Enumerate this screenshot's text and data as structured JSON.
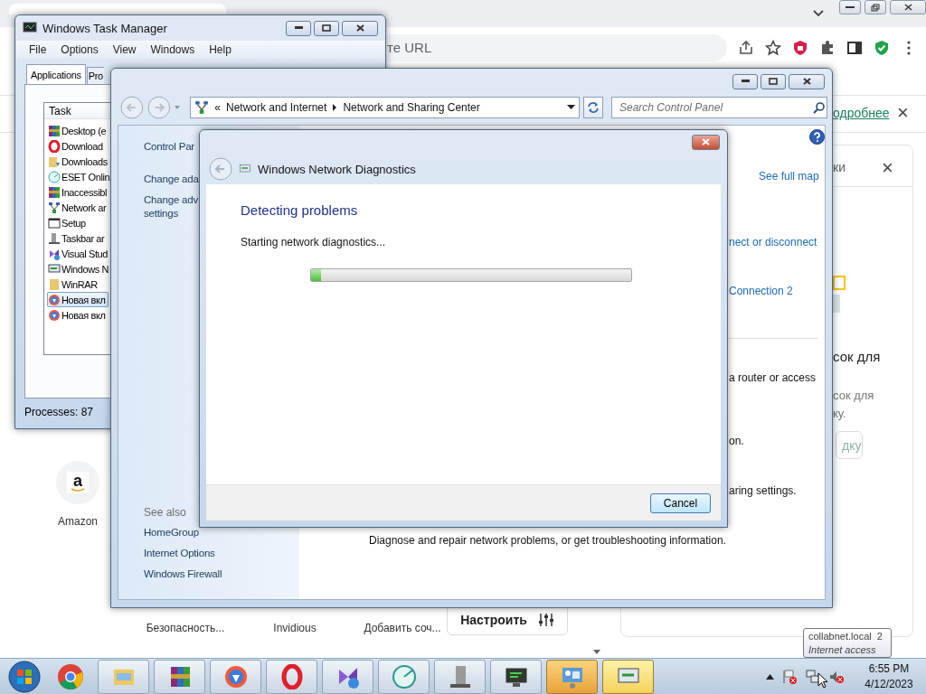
{
  "browser": {
    "url_fragment": "те URL",
    "infobar": {
      "link": "одробнее",
      "close": "×"
    },
    "side_panel": {
      "title": "ки",
      "close": "×",
      "heading": "сок для",
      "text_lines": [
        "сок для",
        "ку."
      ],
      "button": "дку"
    },
    "shortcuts": [
      {
        "label": "Amazon",
        "logo": "a"
      },
      {
        "label": "Безопасность..."
      },
      {
        "label": "Invidious"
      },
      {
        "label": "Добавить соч..."
      }
    ],
    "customize_button": "Настроить"
  },
  "task_manager": {
    "title": "Windows Task Manager",
    "menu": [
      "File",
      "Options",
      "View",
      "Windows",
      "Help"
    ],
    "tabs": [
      {
        "label": "Applications",
        "selected": true
      },
      {
        "label": "Pro",
        "selected": false
      }
    ],
    "column": "Task",
    "tasks": [
      {
        "name": "Desktop (e",
        "selected": false
      },
      {
        "name": "Download",
        "selected": false
      },
      {
        "name": "Downloads",
        "selected": false
      },
      {
        "name": "ESET Onlin",
        "selected": false
      },
      {
        "name": "Inaccessibl",
        "selected": false
      },
      {
        "name": "Network ar",
        "selected": false
      },
      {
        "name": "Setup",
        "selected": false
      },
      {
        "name": "Taskbar ar",
        "selected": false
      },
      {
        "name": "Visual Stud",
        "selected": false
      },
      {
        "name": "Windows N",
        "selected": false
      },
      {
        "name": "WinRAR",
        "selected": false
      },
      {
        "name": "Новая вкл",
        "selected": true
      },
      {
        "name": "Новая вкл",
        "selected": false
      }
    ],
    "status": "Processes: 87"
  },
  "control_panel": {
    "breadcrumb_prefix": "«",
    "breadcrumb": [
      "Network and Internet",
      "Network and Sharing Center"
    ],
    "search": {
      "placeholder": "Search Control Panel"
    },
    "left_links": [
      "Control Par",
      "Change ada",
      "Change adv\nsettings"
    ],
    "see_also_title": "See also",
    "see_also": [
      "HomeGroup",
      "Internet Options",
      "Windows Firewall"
    ],
    "right_pane": [
      {
        "kind": "link",
        "text": "See full map"
      },
      {
        "kind": "link",
        "text": "nect or disconnect"
      },
      {
        "kind": "link",
        "text": "Connection 2"
      },
      {
        "kind": "text",
        "text": "a router or access"
      },
      {
        "kind": "text",
        "text": "on."
      },
      {
        "kind": "text",
        "text": "aring settings."
      },
      {
        "kind": "text",
        "text": "Diagnose and repair network problems, or get troubleshooting information."
      }
    ]
  },
  "diagnostics_dialog": {
    "title": "Windows Network Diagnostics",
    "heading": "Detecting problems",
    "status": "Starting network diagnostics...",
    "progress": {
      "level": 0.03
    },
    "button": "Cancel"
  },
  "taskbar": {
    "apps": [
      {
        "active": false,
        "flashing": false
      },
      {
        "active": false,
        "flashing": false
      },
      {
        "active": false,
        "flashing": false
      },
      {
        "active": false,
        "flashing": false
      },
      {
        "active": false,
        "flashing": false
      },
      {
        "active": false,
        "flashing": false
      },
      {
        "active": false,
        "flashing": false
      },
      {
        "active": false,
        "flashing": false
      },
      {
        "active": false,
        "flashing": true
      },
      {
        "active": true,
        "flashing": false
      }
    ],
    "clock": {
      "time": "6:55 PM",
      "date": "4/12/2023"
    },
    "tooltip": {
      "title": "collabnet.local  2",
      "subtitle": "Internet access"
    }
  }
}
